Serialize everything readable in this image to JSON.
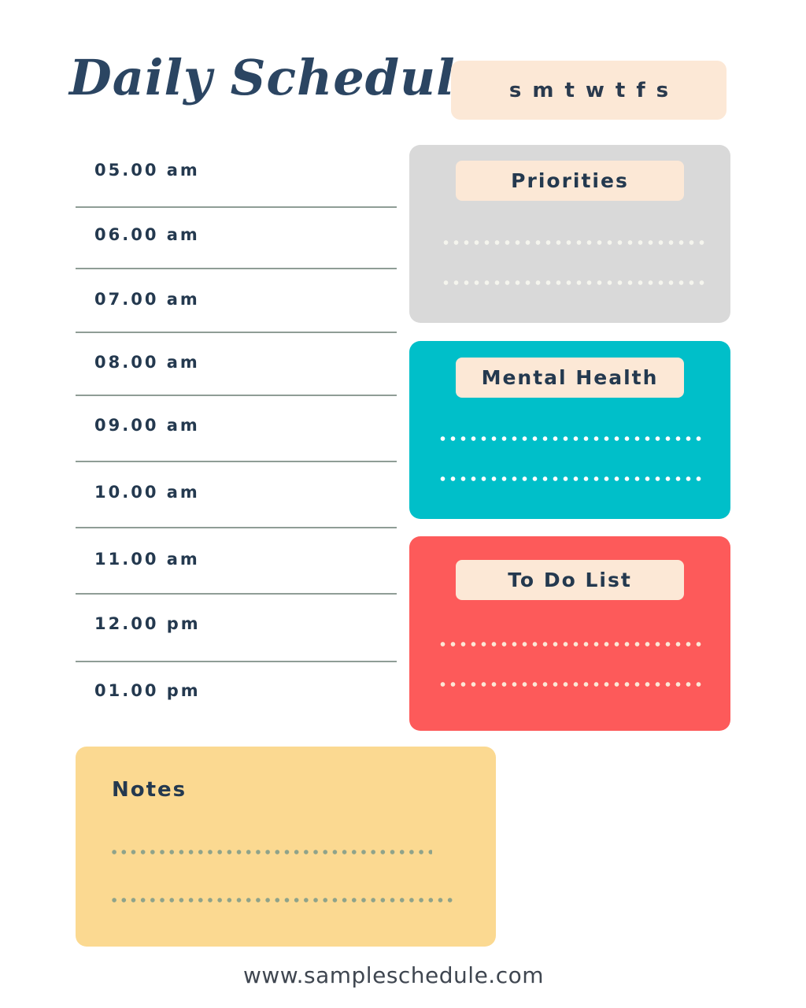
{
  "header": {
    "title": "Daily Schedule",
    "weekdays": [
      "s",
      "m",
      "t",
      "w",
      "t",
      "f",
      "s"
    ]
  },
  "schedule": {
    "slots": [
      "05.00 am",
      "06.00 am",
      "07.00 am",
      "08.00 am",
      "09.00 am",
      "10.00 am",
      "11.00 am",
      "12.00 pm",
      "01.00 pm"
    ]
  },
  "sections": {
    "priorities": {
      "label": "Priorities",
      "color": "#d9d9d9",
      "dot_color": "#f5f5ee"
    },
    "mental_health": {
      "label": "Mental Health",
      "color": "#00bfc9",
      "dot_color": "#ffffff"
    },
    "todo": {
      "label": "To Do List",
      "color": "#fd5a5a",
      "dot_color": "#fce8d6"
    }
  },
  "notes": {
    "label": "Notes",
    "color": "#fbd991",
    "dot_color": "#8fa38a"
  },
  "footer": {
    "url": "www.sampleschedule.com"
  },
  "colors": {
    "text": "#24394f",
    "tag_bg": "#fce8d6",
    "divider": "#8f9d96"
  }
}
